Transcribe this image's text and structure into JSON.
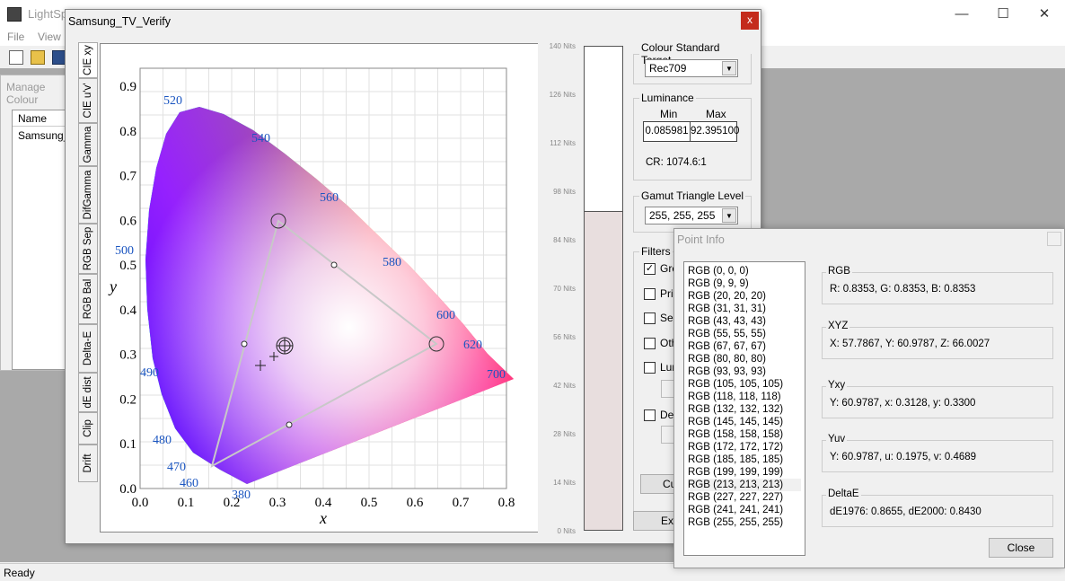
{
  "app": {
    "title": "LightSpace",
    "menu": [
      "File",
      "View"
    ],
    "status": "Ready",
    "caption": {
      "minimize": "—",
      "maximize": "☐",
      "close": "✕"
    }
  },
  "manage": {
    "title": "Manage Colour",
    "column": "Name",
    "row": "Samsung_TV"
  },
  "verify": {
    "title": "Samsung_TV_Verify",
    "close": "x",
    "tabs": [
      "CIE xy",
      "CIE u'v'",
      "Gamma",
      "DifGamma",
      "RGB Sep",
      "RGB Bal",
      "Delta-E",
      "dE dist",
      "Clip",
      "Drift"
    ],
    "plot": {
      "x_axis": "x",
      "y_axis": "y",
      "x_ticks": [
        "0.0",
        "0.1",
        "0.2",
        "0.3",
        "0.4",
        "0.5",
        "0.6",
        "0.7",
        "0.8"
      ],
      "y_ticks": [
        "0.0",
        "0.1",
        "0.2",
        "0.3",
        "0.4",
        "0.5",
        "0.6",
        "0.7",
        "0.8",
        "0.9"
      ],
      "wavelengths": [
        "380",
        "460",
        "470",
        "480",
        "490",
        "500",
        "520",
        "540",
        "560",
        "580",
        "600",
        "620",
        "700"
      ]
    },
    "luminance_scale": [
      "140 Nits",
      "126 Nits",
      "112 Nits",
      "98 Nits",
      "84 Nits",
      "70 Nits",
      "56 Nits",
      "42 Nits",
      "28 Nits",
      "14 Nits",
      "0 Nits"
    ],
    "luminance_level": 0.66,
    "colour_standard": {
      "label": "Colour Standard Target",
      "value": "Rec709"
    },
    "luminance": {
      "label": "Luminance",
      "min_label": "Min",
      "max_label": "Max",
      "min": "0.085981",
      "max": "92.395100",
      "cr": "CR: 1074.6:1"
    },
    "gamut": {
      "label": "Gamut Triangle Level",
      "value": "255, 255, 255"
    },
    "filters": {
      "label": "Filters",
      "items": [
        "Grey",
        "Primaries",
        "Secondaries",
        "Other",
        "Luminance",
        "Delta-E"
      ]
    },
    "buttons": {
      "cu": "Cu",
      "exp": "Exp"
    }
  },
  "point_info": {
    "title": "Point Info",
    "list": [
      "RGB (0, 0, 0)",
      "RGB (9, 9, 9)",
      "RGB (20, 20, 20)",
      "RGB (31, 31, 31)",
      "RGB (43, 43, 43)",
      "RGB (55, 55, 55)",
      "RGB (67, 67, 67)",
      "RGB (80, 80, 80)",
      "RGB (93, 93, 93)",
      "RGB (105, 105, 105)",
      "RGB (118, 118, 118)",
      "RGB (132, 132, 132)",
      "RGB (145, 145, 145)",
      "RGB (158, 158, 158)",
      "RGB (172, 172, 172)",
      "RGB (185, 185, 185)",
      "RGB (199, 199, 199)",
      "RGB (213, 213, 213)",
      "RGB (227, 227, 227)",
      "RGB (241, 241, 241)",
      "RGB (255, 255, 255)"
    ],
    "selected": 17,
    "rgb": {
      "label": "RGB",
      "value": "R: 0.8353, G: 0.8353, B: 0.8353"
    },
    "xyz": {
      "label": "XYZ",
      "value": "X: 57.7867, Y: 60.9787, Z: 66.0027"
    },
    "yxy": {
      "label": "Yxy",
      "value": "Y: 60.9787, x: 0.3128, y: 0.3300"
    },
    "yuv": {
      "label": "Yuv",
      "value": "Y: 60.9787, u: 0.1975, v: 0.4689"
    },
    "deltae": {
      "label": "DeltaE",
      "value": "dE1976: 0.8655, dE2000: 0.8430"
    },
    "close": "Close"
  }
}
